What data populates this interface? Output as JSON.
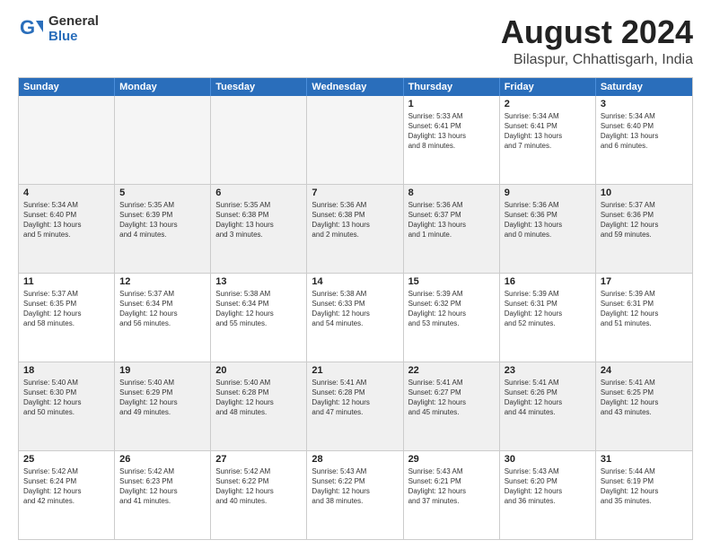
{
  "logo": {
    "general": "General",
    "blue": "Blue"
  },
  "title": "August 2024",
  "subtitle": "Bilaspur, Chhattisgarh, India",
  "header_days": [
    "Sunday",
    "Monday",
    "Tuesday",
    "Wednesday",
    "Thursday",
    "Friday",
    "Saturday"
  ],
  "rows": [
    [
      {
        "day": "",
        "text": "",
        "empty": true
      },
      {
        "day": "",
        "text": "",
        "empty": true
      },
      {
        "day": "",
        "text": "",
        "empty": true
      },
      {
        "day": "",
        "text": "",
        "empty": true
      },
      {
        "day": "1",
        "text": "Sunrise: 5:33 AM\nSunset: 6:41 PM\nDaylight: 13 hours\nand 8 minutes.",
        "empty": false
      },
      {
        "day": "2",
        "text": "Sunrise: 5:34 AM\nSunset: 6:41 PM\nDaylight: 13 hours\nand 7 minutes.",
        "empty": false
      },
      {
        "day": "3",
        "text": "Sunrise: 5:34 AM\nSunset: 6:40 PM\nDaylight: 13 hours\nand 6 minutes.",
        "empty": false
      }
    ],
    [
      {
        "day": "4",
        "text": "Sunrise: 5:34 AM\nSunset: 6:40 PM\nDaylight: 13 hours\nand 5 minutes.",
        "empty": false
      },
      {
        "day": "5",
        "text": "Sunrise: 5:35 AM\nSunset: 6:39 PM\nDaylight: 13 hours\nand 4 minutes.",
        "empty": false
      },
      {
        "day": "6",
        "text": "Sunrise: 5:35 AM\nSunset: 6:38 PM\nDaylight: 13 hours\nand 3 minutes.",
        "empty": false
      },
      {
        "day": "7",
        "text": "Sunrise: 5:36 AM\nSunset: 6:38 PM\nDaylight: 13 hours\nand 2 minutes.",
        "empty": false
      },
      {
        "day": "8",
        "text": "Sunrise: 5:36 AM\nSunset: 6:37 PM\nDaylight: 13 hours\nand 1 minute.",
        "empty": false
      },
      {
        "day": "9",
        "text": "Sunrise: 5:36 AM\nSunset: 6:36 PM\nDaylight: 13 hours\nand 0 minutes.",
        "empty": false
      },
      {
        "day": "10",
        "text": "Sunrise: 5:37 AM\nSunset: 6:36 PM\nDaylight: 12 hours\nand 59 minutes.",
        "empty": false
      }
    ],
    [
      {
        "day": "11",
        "text": "Sunrise: 5:37 AM\nSunset: 6:35 PM\nDaylight: 12 hours\nand 58 minutes.",
        "empty": false
      },
      {
        "day": "12",
        "text": "Sunrise: 5:37 AM\nSunset: 6:34 PM\nDaylight: 12 hours\nand 56 minutes.",
        "empty": false
      },
      {
        "day": "13",
        "text": "Sunrise: 5:38 AM\nSunset: 6:34 PM\nDaylight: 12 hours\nand 55 minutes.",
        "empty": false
      },
      {
        "day": "14",
        "text": "Sunrise: 5:38 AM\nSunset: 6:33 PM\nDaylight: 12 hours\nand 54 minutes.",
        "empty": false
      },
      {
        "day": "15",
        "text": "Sunrise: 5:39 AM\nSunset: 6:32 PM\nDaylight: 12 hours\nand 53 minutes.",
        "empty": false
      },
      {
        "day": "16",
        "text": "Sunrise: 5:39 AM\nSunset: 6:31 PM\nDaylight: 12 hours\nand 52 minutes.",
        "empty": false
      },
      {
        "day": "17",
        "text": "Sunrise: 5:39 AM\nSunset: 6:31 PM\nDaylight: 12 hours\nand 51 minutes.",
        "empty": false
      }
    ],
    [
      {
        "day": "18",
        "text": "Sunrise: 5:40 AM\nSunset: 6:30 PM\nDaylight: 12 hours\nand 50 minutes.",
        "empty": false
      },
      {
        "day": "19",
        "text": "Sunrise: 5:40 AM\nSunset: 6:29 PM\nDaylight: 12 hours\nand 49 minutes.",
        "empty": false
      },
      {
        "day": "20",
        "text": "Sunrise: 5:40 AM\nSunset: 6:28 PM\nDaylight: 12 hours\nand 48 minutes.",
        "empty": false
      },
      {
        "day": "21",
        "text": "Sunrise: 5:41 AM\nSunset: 6:28 PM\nDaylight: 12 hours\nand 47 minutes.",
        "empty": false
      },
      {
        "day": "22",
        "text": "Sunrise: 5:41 AM\nSunset: 6:27 PM\nDaylight: 12 hours\nand 45 minutes.",
        "empty": false
      },
      {
        "day": "23",
        "text": "Sunrise: 5:41 AM\nSunset: 6:26 PM\nDaylight: 12 hours\nand 44 minutes.",
        "empty": false
      },
      {
        "day": "24",
        "text": "Sunrise: 5:41 AM\nSunset: 6:25 PM\nDaylight: 12 hours\nand 43 minutes.",
        "empty": false
      }
    ],
    [
      {
        "day": "25",
        "text": "Sunrise: 5:42 AM\nSunset: 6:24 PM\nDaylight: 12 hours\nand 42 minutes.",
        "empty": false
      },
      {
        "day": "26",
        "text": "Sunrise: 5:42 AM\nSunset: 6:23 PM\nDaylight: 12 hours\nand 41 minutes.",
        "empty": false
      },
      {
        "day": "27",
        "text": "Sunrise: 5:42 AM\nSunset: 6:22 PM\nDaylight: 12 hours\nand 40 minutes.",
        "empty": false
      },
      {
        "day": "28",
        "text": "Sunrise: 5:43 AM\nSunset: 6:22 PM\nDaylight: 12 hours\nand 38 minutes.",
        "empty": false
      },
      {
        "day": "29",
        "text": "Sunrise: 5:43 AM\nSunset: 6:21 PM\nDaylight: 12 hours\nand 37 minutes.",
        "empty": false
      },
      {
        "day": "30",
        "text": "Sunrise: 5:43 AM\nSunset: 6:20 PM\nDaylight: 12 hours\nand 36 minutes.",
        "empty": false
      },
      {
        "day": "31",
        "text": "Sunrise: 5:44 AM\nSunset: 6:19 PM\nDaylight: 12 hours\nand 35 minutes.",
        "empty": false
      }
    ]
  ]
}
